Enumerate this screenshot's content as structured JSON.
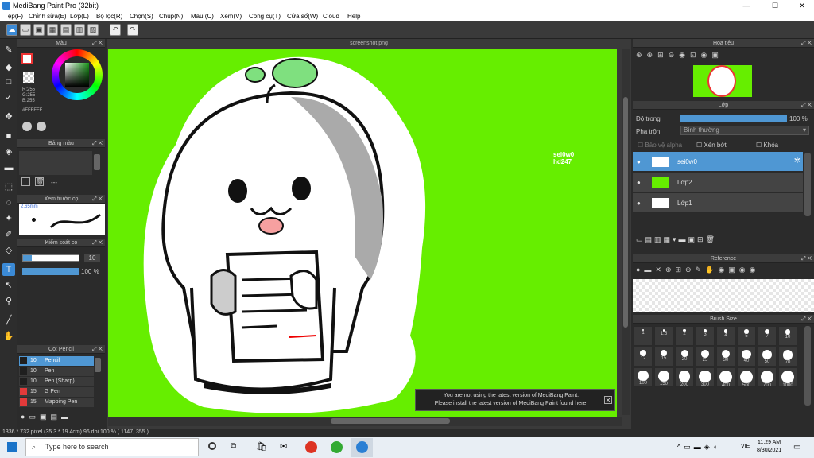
{
  "window": {
    "title": "MediBang Paint Pro (32bit)",
    "minimize": "—",
    "maximize": "☐",
    "close": "✕"
  },
  "menu": [
    "Tệp(F)",
    "Chỉnh sửa(E)",
    "Lớp(L)",
    "Bộ lọc(R)",
    "Chọn(S)",
    "Chụp(N)",
    "Màu (C)",
    "Xem(V)",
    "Công cụ(T)",
    "Cửa sổ(W)",
    "Cloud",
    "Help"
  ],
  "color_panel": {
    "title": "Màu",
    "values": [
      "R:255",
      "G:255",
      "B:255"
    ],
    "hex": "#FFFFFF"
  },
  "palette_panel": {
    "title": "Bảng màu",
    "dash": "---"
  },
  "brush_preview": {
    "title": "Xem trước cọ",
    "size": "2.65mm"
  },
  "control_panel": {
    "title": "Kiểm soát cọ",
    "size_value": "10",
    "opacity_value": "100 %"
  },
  "brush_list": {
    "title": "Cọ: Pencil",
    "items": [
      {
        "size": "10",
        "name": "Pencil",
        "color": "#1f1f1f",
        "selected": true
      },
      {
        "size": "10",
        "name": "Pen",
        "color": "#1f1f1f",
        "selected": false
      },
      {
        "size": "10",
        "name": "Pen (Sharp)",
        "color": "#1f1f1f",
        "selected": false
      },
      {
        "size": "15",
        "name": "G Pen",
        "color": "#e23a3a",
        "selected": false
      },
      {
        "size": "15",
        "name": "Mapping Pen",
        "color": "#e23a3a",
        "selected": false
      }
    ]
  },
  "canvas": {
    "tab": "screenshot.png",
    "watermark_1": "sei0w0",
    "watermark_2": "hd247",
    "bg_color": "#66ee00"
  },
  "notice": {
    "line1": "You are not using the latest version of MediBang Paint.",
    "line2": "Please install the latest version of MediBang Paint found here."
  },
  "navigator": {
    "title": "Hoa tiêu"
  },
  "layer_panel": {
    "title": "Lớp",
    "opacity_label": "Độ trong",
    "opacity_value": "100 %",
    "blend_label": "Pha trộn",
    "blend_value": "Bình thường",
    "protect_alpha": "Bảo vệ alpha",
    "clipping": "Xén bớt",
    "lock": "Khóa",
    "layers": [
      {
        "name": "sei0w0",
        "selected": true
      },
      {
        "name": "Lớp2",
        "selected": false
      },
      {
        "name": "Lớp1",
        "selected": false
      }
    ]
  },
  "reference": {
    "title": "Reference"
  },
  "brush_size": {
    "title": "Brush Size",
    "sizes": [
      "1",
      "1.5",
      "2",
      "3",
      "4",
      "5",
      "7",
      "10",
      "12",
      "15",
      "20",
      "25",
      "30",
      "40",
      "50",
      "70",
      "100",
      "150",
      "200",
      "300",
      "400",
      "500",
      "700",
      "1000"
    ]
  },
  "status": {
    "text": "1336 * 732 pixel  (35.3 * 19.4cm)  96 dpi  100 %  ( 1147, 355 )"
  },
  "taskbar": {
    "search": "Type here to search",
    "time": "11:29 AM",
    "date": "8/30/2021",
    "lang": "VIE"
  }
}
